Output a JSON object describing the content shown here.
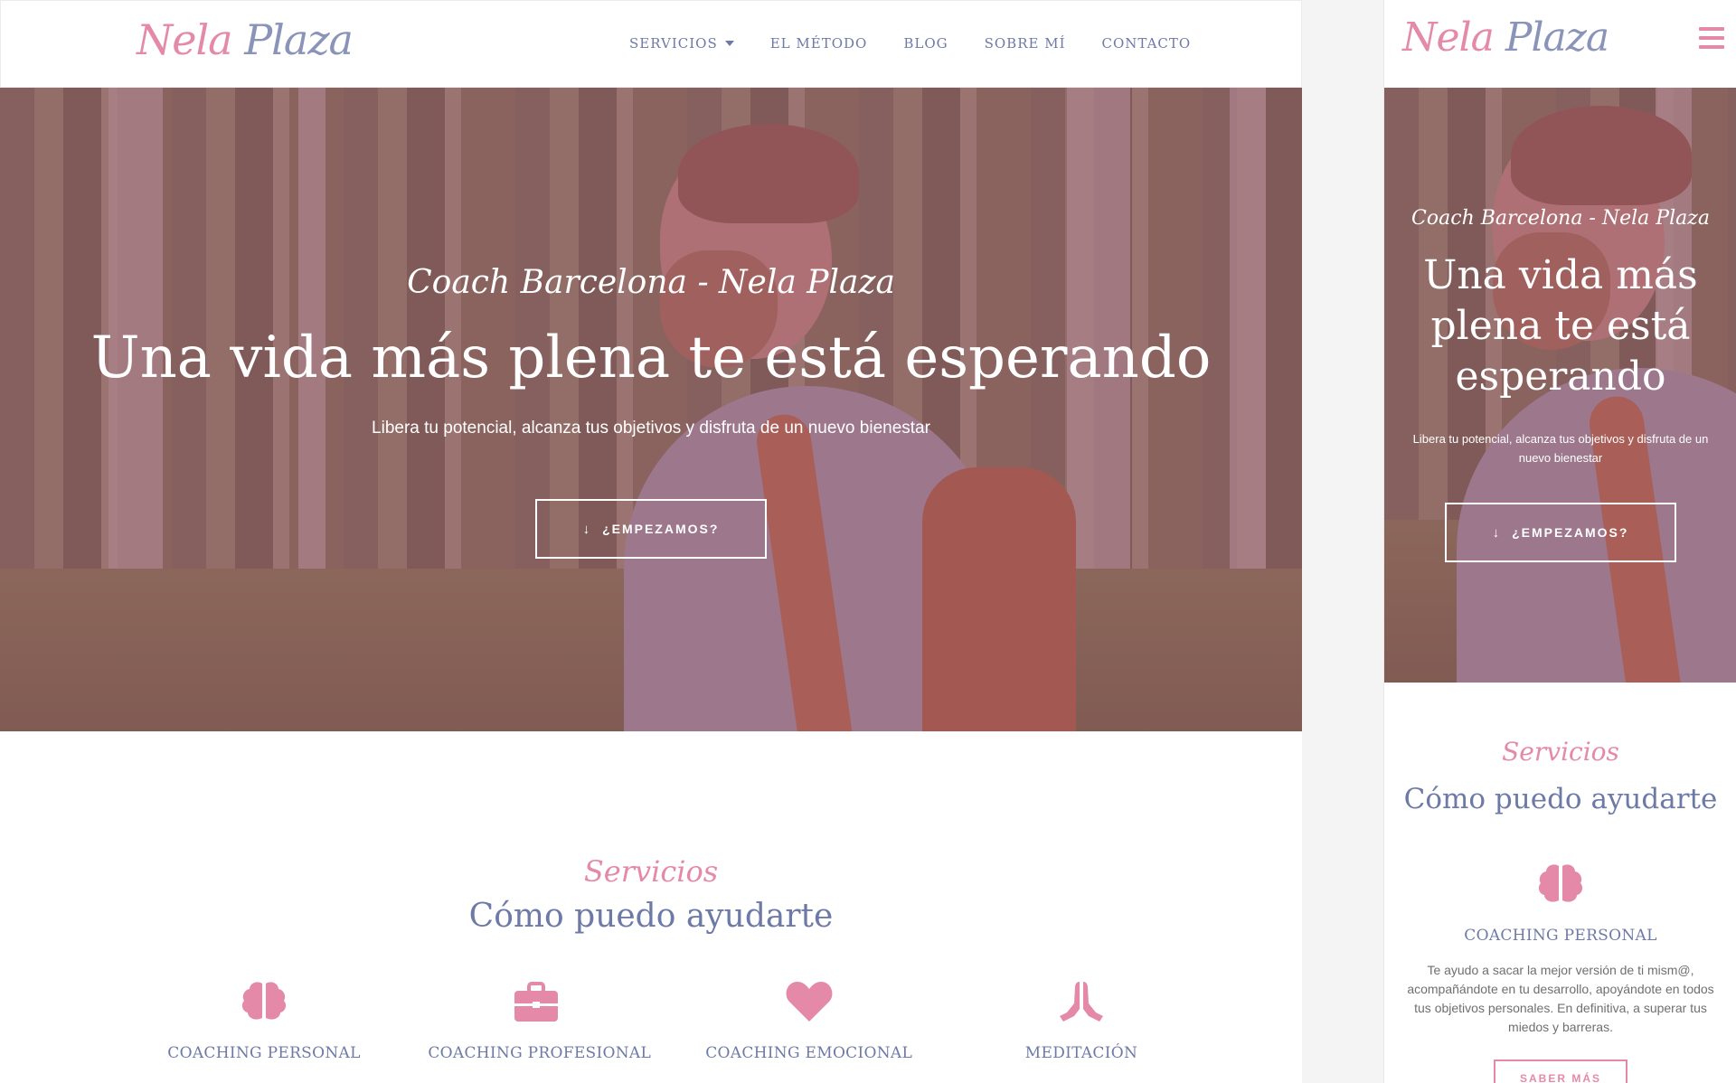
{
  "brand": {
    "logo_part1": "Nela",
    "logo_part2": "Plaza"
  },
  "nav": {
    "items": [
      "SERVICIOS",
      "EL MÉTODO",
      "BLOG",
      "SOBRE MÍ",
      "CONTACTO"
    ],
    "dropdown_item": "SERVICIOS"
  },
  "hero": {
    "subtitle": "Coach Barcelona - Nela Plaza",
    "title": "Una vida más plena te está esperando",
    "lead": "Libera tu potencial, alcanza tus objetivos y disfruta de un nuevo bienestar",
    "cta": "¿EMPEZAMOS?"
  },
  "services_section": {
    "kicker": "Servicios",
    "title": "Cómo puedo ayudarte",
    "items": [
      {
        "name": "COACHING PERSONAL",
        "icon": "brain-icon"
      },
      {
        "name": "COACHING PROFESIONAL",
        "icon": "briefcase-icon"
      },
      {
        "name": "COACHING EMOCIONAL",
        "icon": "heart-icon"
      },
      {
        "name": "MEDITACIÓN",
        "icon": "praying-hands-icon"
      }
    ]
  },
  "mobile": {
    "service_name": "COACHING PERSONAL",
    "service_desc": "Te ayudo a sacar la mejor versión de ti mism@, acompañándote en tu desarrollo, apoyándote en todos tus objetivos personales. En definitiva, a superar tus miedos y barreras.",
    "more_button": "SABER MÁS"
  },
  "colors": {
    "accent": "#e48aa8",
    "text_blue": "#6e7aa6",
    "hero_overlay": "#96506988"
  }
}
